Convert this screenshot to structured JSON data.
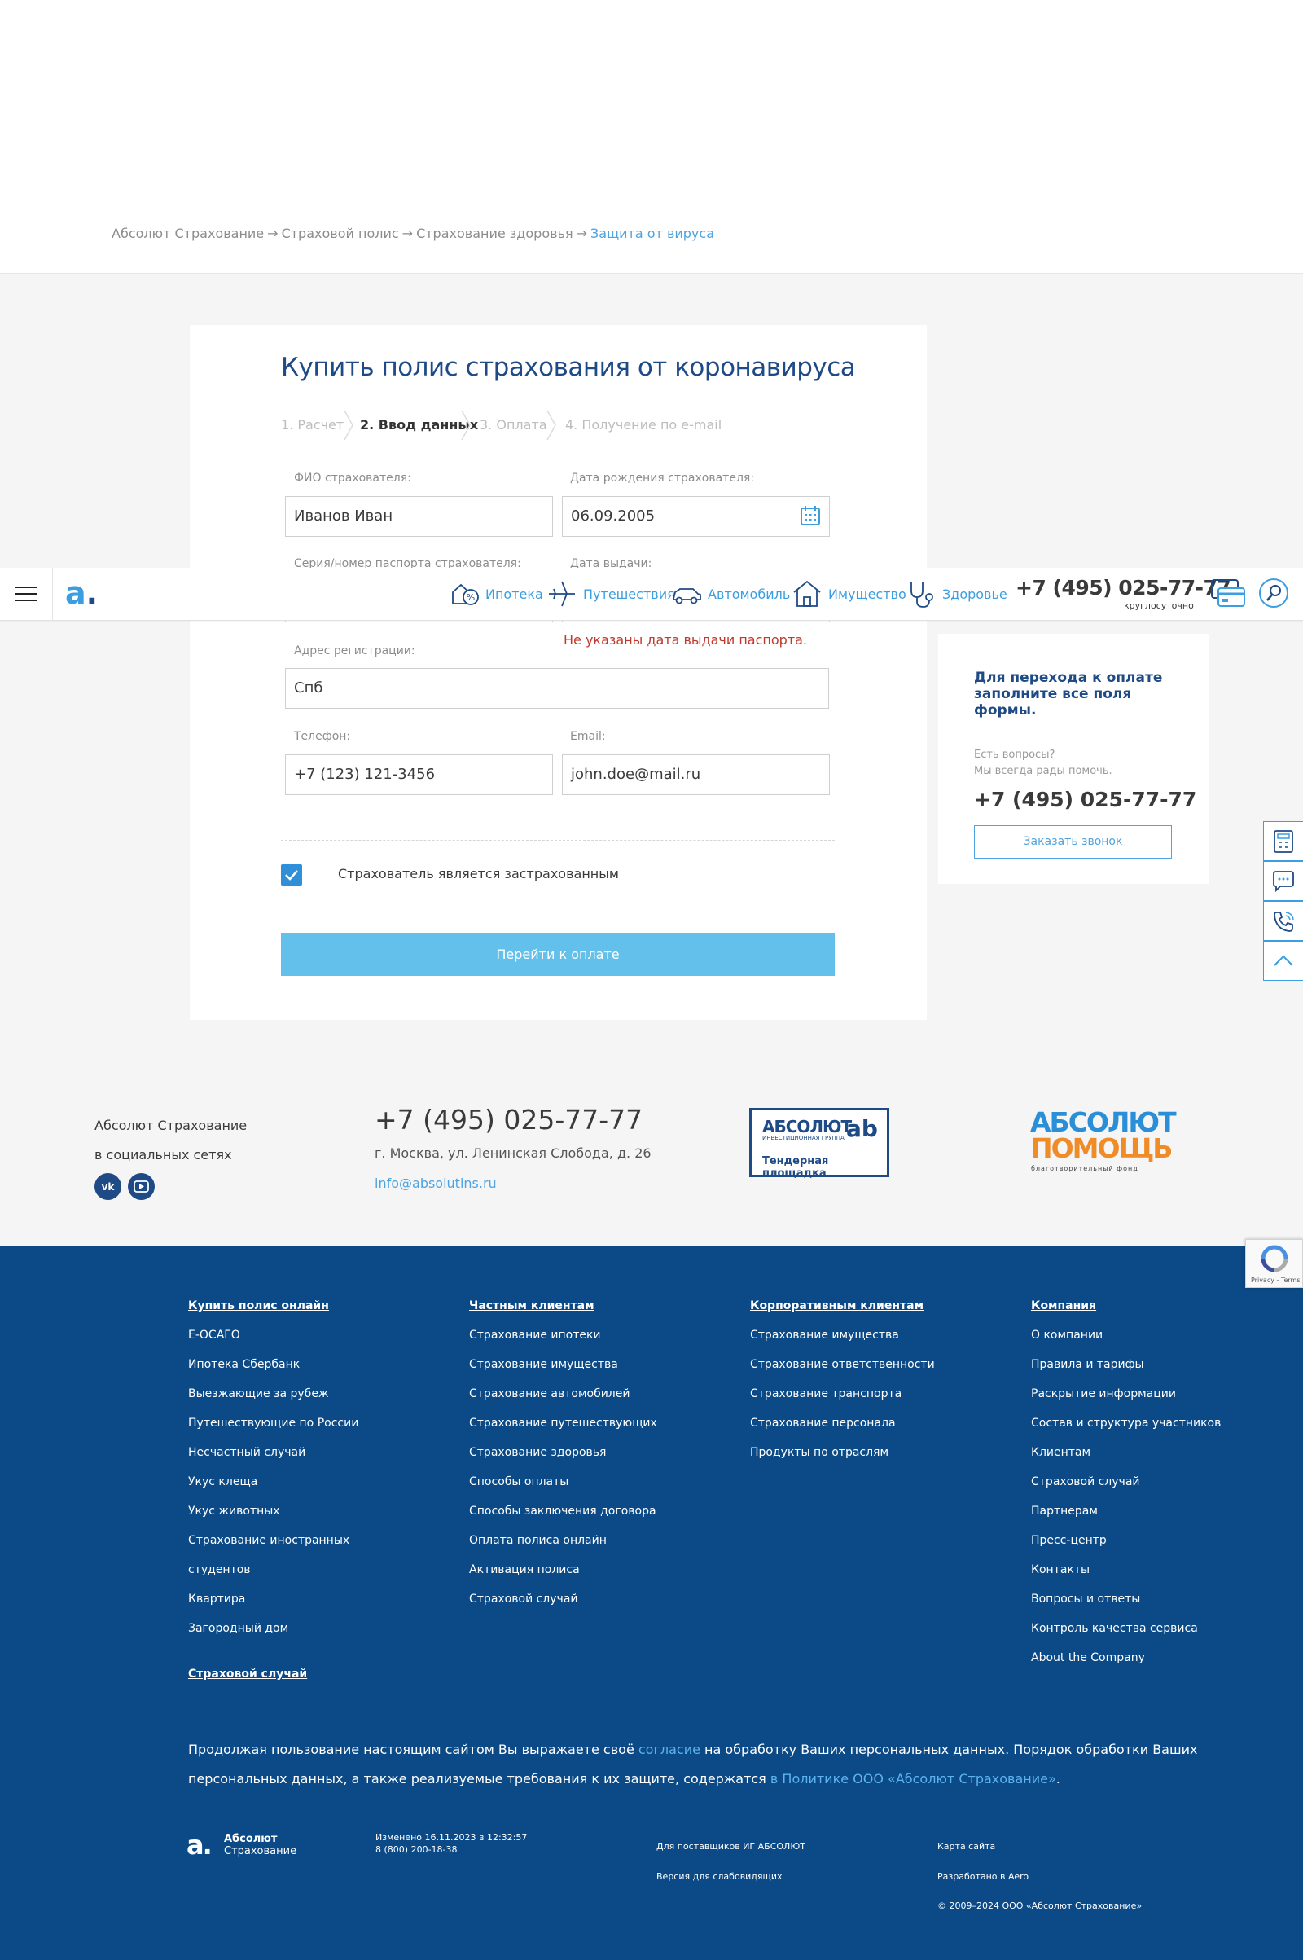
{
  "breadcrumb": {
    "items": [
      "Абсолют Страхование",
      "Страховой полис",
      "Страхование здоровья"
    ],
    "separator": "→",
    "current": "Защита от вируса"
  },
  "form": {
    "title": "Купить полис страхования от коронавируса",
    "steps": [
      "1. Расчет",
      "2. Ввод данных",
      "3. Оплата",
      "4. Получение по e-mail"
    ],
    "active_step": 2,
    "fields": {
      "fio": {
        "label": "ФИО страхователя:",
        "value": "Иванов Иван"
      },
      "birth_date": {
        "label": "Дата рождения страхователя:",
        "value": "06.09.2005"
      },
      "passport": {
        "label": "Серия/номер паспорта страхователя:",
        "value": ""
      },
      "issue_date": {
        "label": "Дата выдачи:",
        "value": "",
        "error": "Не указаны дата выдачи паспорта."
      },
      "address": {
        "label": "Адрес регистрации:",
        "value": "Спб"
      },
      "phone": {
        "label": "Телефон:",
        "value": "+7 (123) 121-3456"
      },
      "email": {
        "label": "Email:",
        "value": "john.doe@mail.ru"
      }
    },
    "checkbox": {
      "label": "Страхователь является застрахованным",
      "checked": true
    },
    "submit_label": "Перейти к оплате"
  },
  "header": {
    "nav": [
      {
        "label": "Ипотека",
        "icon": "mortgage-icon"
      },
      {
        "label": "Путешествия",
        "icon": "plane-icon"
      },
      {
        "label": "Автомобиль",
        "icon": "car-icon"
      },
      {
        "label": "Имущество",
        "icon": "house-icon"
      },
      {
        "label": "Здоровье",
        "icon": "stethoscope-icon"
      }
    ],
    "phone": "+7 (495) 025-77-77",
    "phone_note": "круглосуточно",
    "accent_color": "#3a9ee0"
  },
  "sidebar": {
    "heading": "Для перехода к оплате заполните все поля формы.",
    "question_line1": "Есть вопросы?",
    "question_line2": "Мы всегда рады помочь.",
    "phone": "+7 (495) 025-77-77",
    "callback_label": "Заказать звонок"
  },
  "contacts": {
    "social_line1": "Абсолют Страхование",
    "social_line2": "в социальных сетях",
    "phone": "+7 (495) 025-77-77",
    "address": "г. Москва, ул. Ленинская Слобода, д. 26",
    "email": "info@absolutins.ru",
    "tender_logo": {
      "line1": "АБСОЛЮТ",
      "line2": "ИНВЕСТИЦИОННАЯ ГРУППА",
      "line3": "Тендерная площадка",
      "mark": "аb"
    },
    "help_logo": {
      "line1": "АБСОЛЮТ",
      "line2": "ПОМОЩЬ",
      "line3": "благотворительный фонд"
    }
  },
  "footer": {
    "columns": [
      {
        "heading": "Купить полис онлайн",
        "links": [
          "Е-ОСАГО",
          "Ипотека Сбербанк",
          "Выезжающие за рубеж",
          "Путешествующие по России",
          "Несчастный случай",
          "Укус клеща",
          "Укус животных",
          "Страхование иностранных",
          "студентов",
          "Квартира",
          "Загородный дом"
        ]
      },
      {
        "heading": "Частным клиентам",
        "links": [
          "Страхование ипотеки",
          "Страхование имущества",
          "Страхование автомобилей",
          "Страхование путешествующих",
          "Страхование здоровья",
          "Способы оплаты",
          "Способы заключения договора",
          "Оплата полиса онлайн",
          "Активация полиса",
          "Страховой случай"
        ]
      },
      {
        "heading": "Корпоративным клиентам",
        "links": [
          "Страхование имущества",
          "Страхование ответственности",
          "Страхование транспорта",
          "Страхование персонала",
          "Продукты по отраслям"
        ]
      },
      {
        "heading": "Компания",
        "links": [
          "О компании",
          "Правила и тарифы",
          "Раскрытие информации",
          "Состав и структура участников",
          "Клиентам",
          "Страховой случай",
          "Партнерам",
          "Пресс-центр",
          "Контакты",
          "Вопросы и ответы",
          "Контроль качества сервиса",
          "About the Company"
        ]
      }
    ],
    "extra_heading": "Страховой случай",
    "consent": {
      "part1": "Продолжая пользование настоящим сайтом Вы выражаете своё ",
      "link1": "согласие",
      "part2": " на обработку Ваших персональных данных. Порядок обработки Ваших персональных данных, а также реализуемые требования к их защите, содержатся ",
      "link2": "в Политике ООО «Абсолют Страхование»",
      "part3": "."
    },
    "logo": {
      "mark": "a.",
      "line1": "Абсолют",
      "line2": "Страхование"
    },
    "changed": "Изменено 16.11.2023 в 12:32:57",
    "hotline": "8 (800) 200-18-38",
    "suppliers": "Для поставщиков ИГ АБСОЛЮТ",
    "accessible": "Версия для слабовидящих",
    "sitemap": "Карта сайта",
    "developed": "Разработано в Aero",
    "copyright": "© 2009–2024 ООО «Абсолют Страхование»"
  },
  "recaptcha": {
    "text": "Privacy - Terms"
  }
}
